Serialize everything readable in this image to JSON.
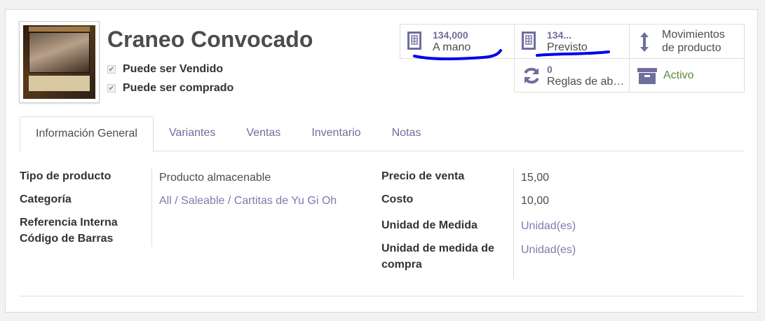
{
  "product": {
    "name": "Craneo Convocado",
    "can_be_sold_label": "Puede ser Vendido",
    "can_be_sold": true,
    "can_be_purchased_label": "Puede ser comprado",
    "can_be_purchased": true
  },
  "smart_buttons": {
    "on_hand": {
      "value": "134,000",
      "label": "A mano",
      "icon": "building-icon"
    },
    "forecasted": {
      "value": "134...",
      "label": "Previsto",
      "icon": "building-icon"
    },
    "moves": {
      "label_line1": "Movimientos",
      "label_line2": "de producto",
      "icon": "vertical-arrows-icon"
    },
    "reorder": {
      "value": "0",
      "label": "Reglas de ab…",
      "icon": "refresh-icon"
    },
    "active": {
      "label": "Activo",
      "icon": "archive-icon"
    }
  },
  "tabs": [
    "Información General",
    "Variantes",
    "Ventas",
    "Inventario",
    "Notas"
  ],
  "general": {
    "product_type_label": "Tipo de producto",
    "product_type": "Producto almacenable",
    "category_label": "Categoría",
    "category": "All / Saleable / Cartitas de Yu Gi Oh",
    "internal_ref_label": "Referencia Interna",
    "barcode_label": "Código de Barras",
    "sale_price_label": "Precio de venta",
    "sale_price": "15,00",
    "cost_label": "Costo",
    "cost": "10,00",
    "uom_label": "Unidad de Medida",
    "uom": "Unidad(es)",
    "purchase_uom_label_line1": "Unidad de medida de",
    "purchase_uom_label_line2": "compra",
    "purchase_uom": "Unidad(es)"
  },
  "colors": {
    "accent": "#7c7bad",
    "active_green": "#5a8a3a",
    "scribble_blue": "#0000ee"
  }
}
